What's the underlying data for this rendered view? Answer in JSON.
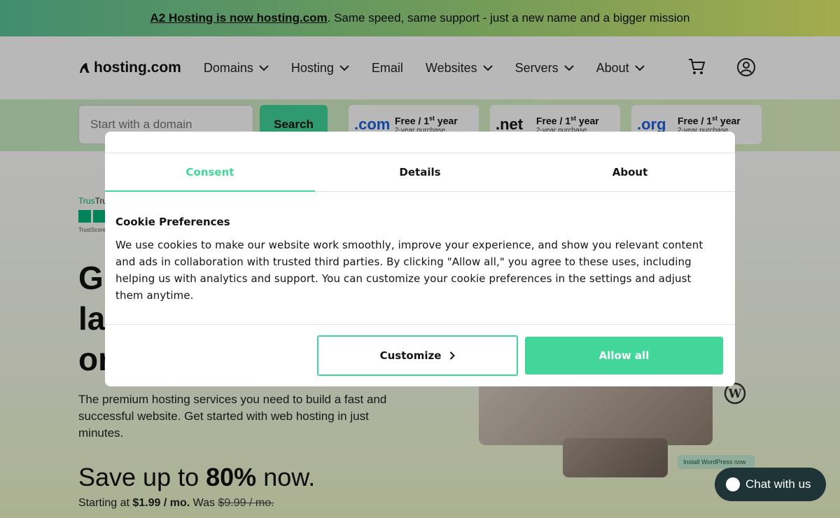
{
  "banner": {
    "link_text": "A2 Hosting is now hosting.com",
    "rest_text": ". Same speed, same support - just a new name and a bigger mission"
  },
  "nav": {
    "logo_text": "hosting.com",
    "items": [
      {
        "label": "Domains"
      },
      {
        "label": "Hosting"
      },
      {
        "label": "Email"
      },
      {
        "label": "Websites"
      },
      {
        "label": "Servers"
      },
      {
        "label": "About"
      }
    ],
    "icons": [
      "cart-icon",
      "account-icon"
    ]
  },
  "domain_search": {
    "placeholder": "Start with a domain",
    "button_label": "Search",
    "offers": [
      {
        "tld": ".com",
        "offer": "Free / 1",
        "sup": "st",
        "offer_suffix": " year",
        "sub": "2-year purchase"
      },
      {
        "tld": ".net",
        "offer": "Free / 1",
        "sup": "st",
        "offer_suffix": " year",
        "sub": "2-year purchase"
      },
      {
        "tld": ".org",
        "offer": "Free / 1",
        "sup": "st",
        "offer_suffix": " year",
        "sub": "2-year purchase"
      }
    ]
  },
  "hero": {
    "trust_label": "Trus",
    "trust_score": "TrustScore",
    "title_lines": [
      "G",
      "la",
      "or"
    ],
    "description": "The premium hosting services you need to build a fast and successful website. Get started with web hosting in just minutes.",
    "save_prefix": "Save up to ",
    "save_value": "80%",
    "save_suffix": " now.",
    "price_prefix": "Starting at ",
    "price_value": "$1.99 / mo.",
    "price_was_label": " Was ",
    "price_was": "$9.99 / mo.",
    "install_label": "Install WordPress now"
  },
  "chat": {
    "label": "Chat with us"
  },
  "modal": {
    "tabs": [
      {
        "label": "Consent",
        "active": true
      },
      {
        "label": "Details",
        "active": false
      },
      {
        "label": "About",
        "active": false
      }
    ],
    "heading": "Cookie Preferences",
    "body": "We use cookies to make our website work smoothly, improve your experience, and show you relevant content and ads in collaboration with trusted third parties. By clicking \"Allow all,\" you agree to these uses, including helping us with analytics and support. You can customize your cookie preferences in the settings and adjust them anytime.",
    "customize_label": "Customize",
    "allow_label": "Allow all"
  },
  "colors": {
    "accent": "#42d69a",
    "chat_bg": "#1e3437",
    "tld_blue": "#2161e0"
  }
}
